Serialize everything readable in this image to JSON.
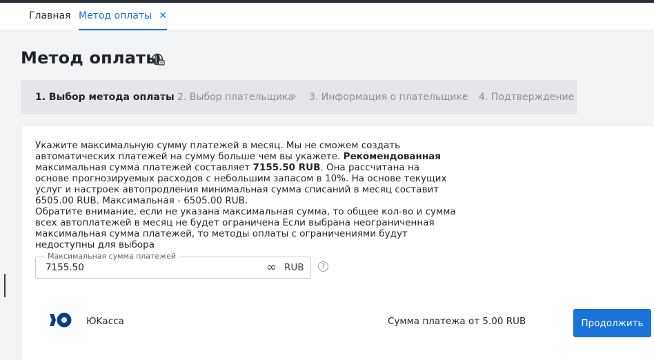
{
  "tabs": [
    {
      "label": "Главная",
      "active": false
    },
    {
      "label": "Метод оплаты",
      "active": true,
      "close_icon": "close-icon"
    }
  ],
  "tab_close_glyph": "✕",
  "page_title": "Метод оплаты",
  "title_icon": "globe-icon",
  "steps": [
    {
      "label": "1. Выбор метода оплаты",
      "active": true
    },
    {
      "label": "2. Выбор плательщика",
      "active": false
    },
    {
      "label": "3. Информация о плательщике",
      "active": false
    },
    {
      "label": "4. Подтверждение",
      "active": false
    }
  ],
  "step_separator": "›",
  "info": {
    "p1_a": "Укажите максимальную сумму платежей в месяц. Мы не сможем создать автоматических платежей на сумму больше чем вы укажете. ",
    "p1_bold": "Рекомендованная",
    "p1_b": " максимальная сумма платежей составляет ",
    "p1_amount": "7155.50 RUB",
    "p1_c": ". Она рассчитана на основе прогнозируемых расходов с небольшим запасом в 10%. На основе текущих услуг и настроек автопродления минимальная сумма списаний в месяц составит 6505.00 RUB. Максимальная - 6505.00 RUB.",
    "p2": "Обратите внимание, если не указана максимальная сумма, то общее кол-во и сумма всех автоплатежей в месяц не будет ограничена Если выбрана неограниченная максимальная сумма платежей, то методы оплаты с ограничениями будут недоступны для выбора"
  },
  "max_amount_field": {
    "label": "Максимальная сумма платежей",
    "value": "7155.50",
    "currency": "RUB",
    "infinity_glyph": "∞",
    "help_glyph": "?"
  },
  "provider": {
    "name": "ЮKасса",
    "logo": "yookassa-logo",
    "amount_note": "Сумма платежа от 5.00 RUB"
  },
  "continue_label": "Продолжить",
  "colors": {
    "accent": "#1a73d9",
    "logo": "#0a3d91"
  }
}
